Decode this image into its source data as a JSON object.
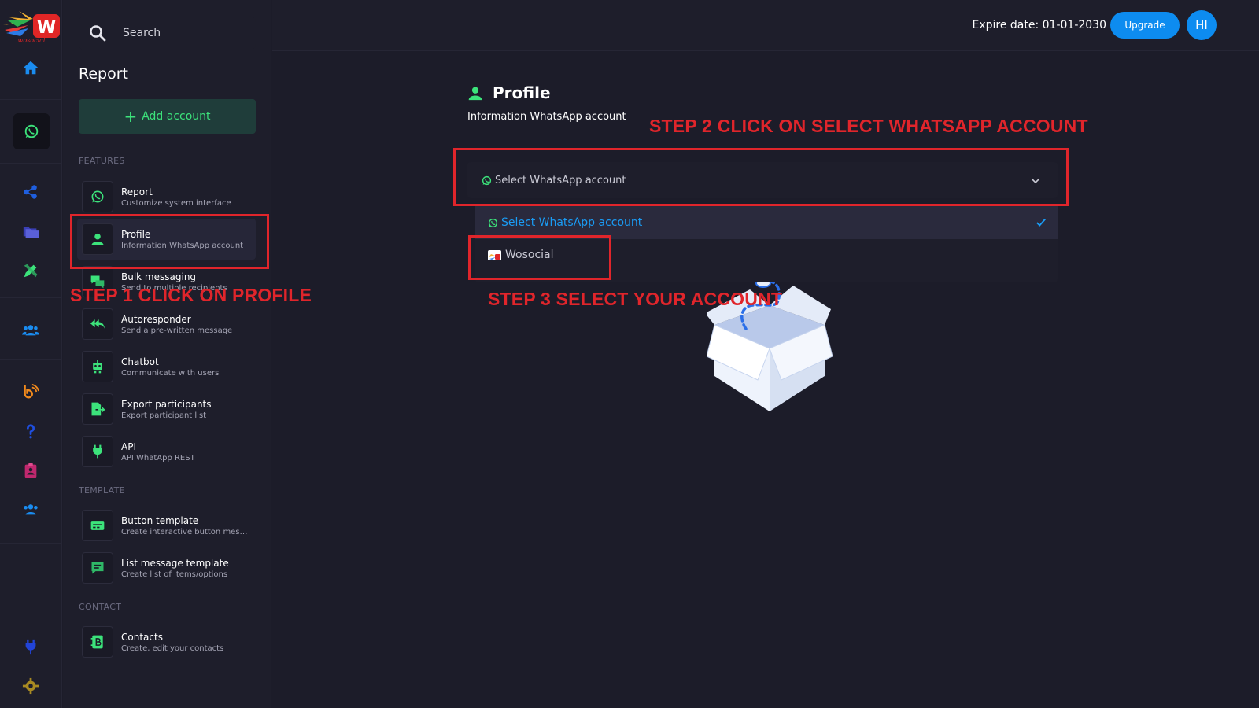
{
  "brand": {
    "name": "wosocial"
  },
  "search": {
    "placeholder": "Search"
  },
  "panel": {
    "title": "Report",
    "add_account_label": "Add account",
    "sections": {
      "features": "FEATURES",
      "template": "TEMPLATE",
      "contact": "CONTACT"
    },
    "features": [
      {
        "title": "Report",
        "desc": "Customize system interface",
        "icon": "whatsapp-icon"
      },
      {
        "title": "Profile",
        "desc": "Information WhatsApp account",
        "icon": "user-icon"
      },
      {
        "title": "Bulk messaging",
        "desc": "Send to multiple recipients",
        "icon": "chat-bubbles-icon"
      },
      {
        "title": "Autoresponder",
        "desc": "Send a pre-written message",
        "icon": "reply-all-icon"
      },
      {
        "title": "Chatbot",
        "desc": "Communicate with users",
        "icon": "robot-icon"
      },
      {
        "title": "Export participants",
        "desc": "Export participant list",
        "icon": "export-icon"
      },
      {
        "title": "API",
        "desc": "API WhatApp REST",
        "icon": "plug-icon"
      }
    ],
    "templates": [
      {
        "title": "Button template",
        "desc": "Create interactive button messages",
        "icon": "button-template-icon"
      },
      {
        "title": "List message template",
        "desc": "Create list of items/options",
        "icon": "list-message-icon"
      }
    ],
    "contacts": [
      {
        "title": "Contacts",
        "desc": "Create, edit your contacts",
        "icon": "contacts-book-icon"
      }
    ]
  },
  "header": {
    "expire_label": "Expire date: 01-01-2030",
    "upgrade_label": "Upgrade",
    "avatar_initials": "HI"
  },
  "main": {
    "title": "Profile",
    "subtitle": "Information WhatsApp account",
    "select_placeholder": "Select WhatsApp account",
    "options": [
      {
        "label": "Select WhatsApp account",
        "selected": true
      },
      {
        "label": "Wosocial",
        "selected": false
      }
    ]
  },
  "annotations": {
    "step1": "STEP 1 CLICK ON PROFILE",
    "step2": "STEP 2 CLICK ON  SELECT WHATSAPP ACCOUNT",
    "step3": "STEP 3 SELECT YOUR ACCOUNT"
  },
  "colors": {
    "background": "#1c1c29",
    "panel": "#1e1e2b",
    "accent_green": "#3ce37b",
    "accent_blue": "#0d8cf0",
    "annotation_red": "#e0252b"
  }
}
